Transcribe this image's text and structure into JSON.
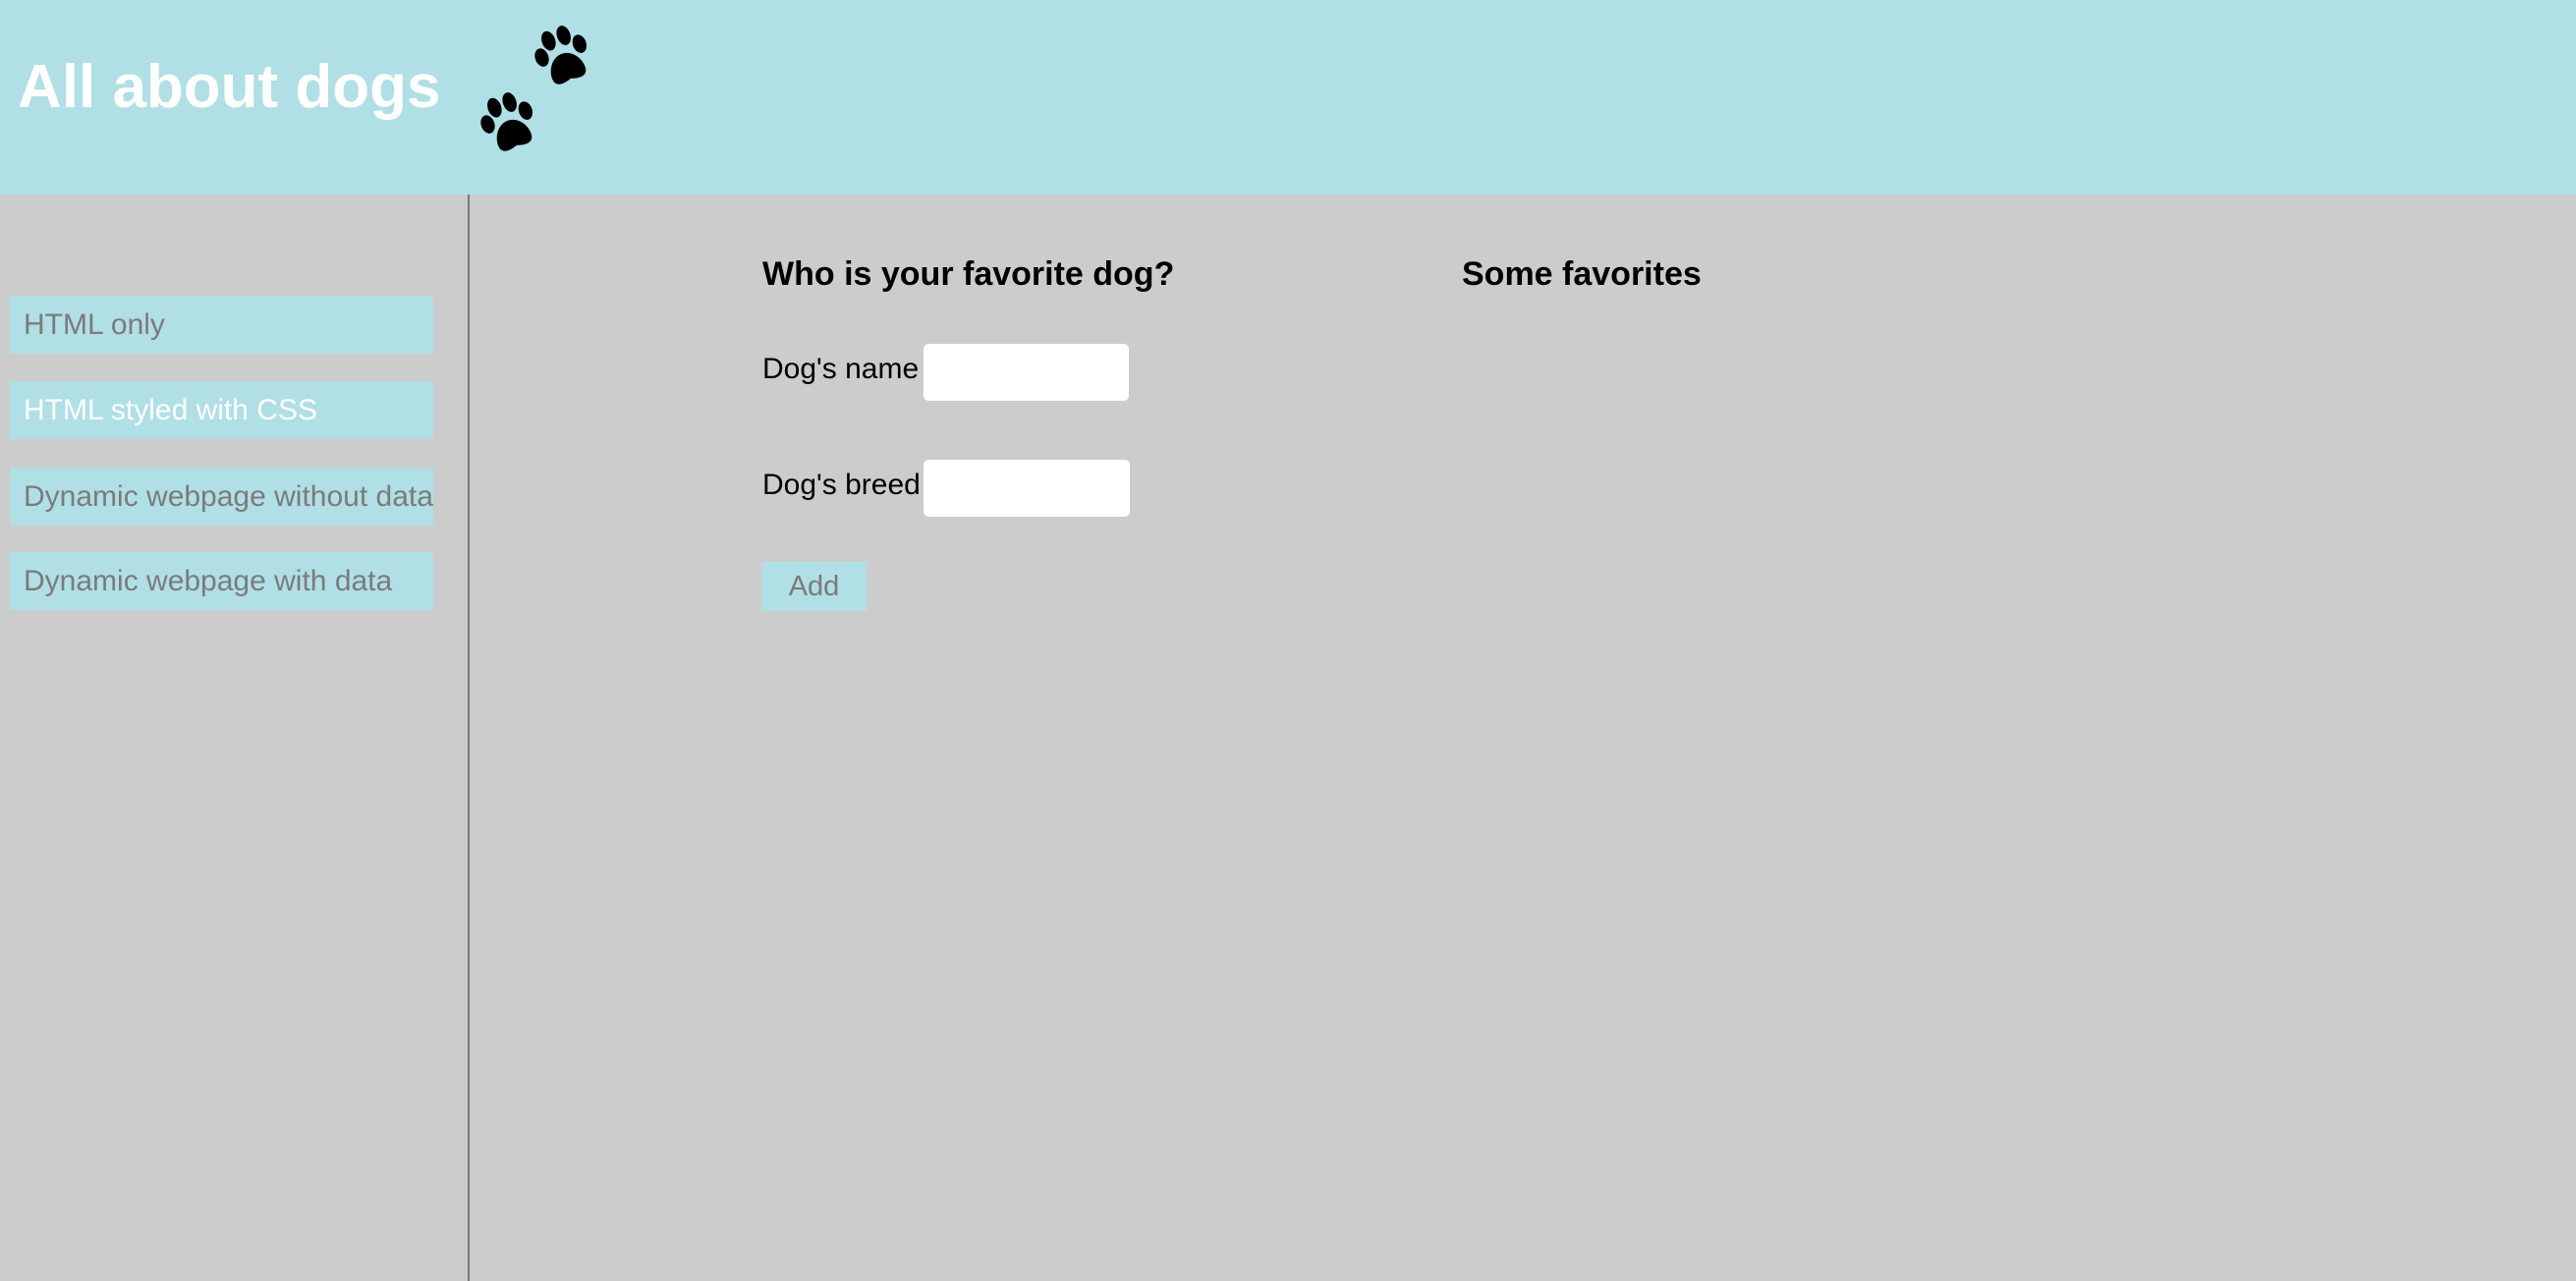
{
  "header": {
    "title": "All about dogs",
    "logo_icon": "paw-prints-icon"
  },
  "sidebar": {
    "items": [
      {
        "label": "HTML only",
        "active": false
      },
      {
        "label": "HTML styled with CSS",
        "active": true
      },
      {
        "label": "Dynamic webpage without data",
        "active": false
      },
      {
        "label": "Dynamic webpage with data",
        "active": false
      }
    ]
  },
  "form": {
    "heading": "Who is your favorite dog?",
    "name_label": "Dog's name",
    "name_value": "",
    "breed_label": "Dog's breed",
    "breed_value": "",
    "add_label": "Add"
  },
  "favorites": {
    "heading": "Some favorites",
    "items": []
  },
  "colors": {
    "header_bg": "#b0dfe5",
    "page_bg": "#cccccc",
    "nav_bg": "#b0dfe5",
    "nav_text": "#7b7b7b",
    "nav_text_active": "#ffffff",
    "title_text": "#ffffff"
  }
}
